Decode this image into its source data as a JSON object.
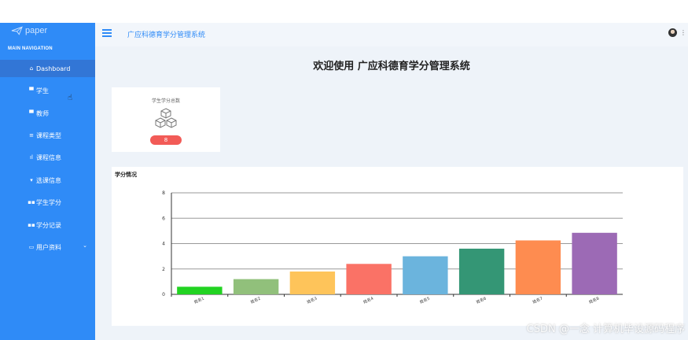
{
  "sidebar": {
    "logo_text": "paper",
    "nav_heading": "MAIN NAVIGATION",
    "items": [
      {
        "label": "Dashboard",
        "icon": "home-icon"
      },
      {
        "label": "学生",
        "icon": "chat-icon"
      },
      {
        "label": "教师",
        "icon": "card-icon"
      },
      {
        "label": "课程类型",
        "icon": "list-icon"
      },
      {
        "label": "课程信息",
        "icon": "bar-chart-icon"
      },
      {
        "label": "选课信息",
        "icon": "pin-icon"
      },
      {
        "label": "学生学分",
        "icon": "grid-icon"
      },
      {
        "label": "学分记录",
        "icon": "grid-icon"
      },
      {
        "label": "用户资料",
        "icon": "id-card-icon"
      }
    ]
  },
  "header": {
    "title": "广应科德育学分管理系统"
  },
  "main": {
    "welcome": "欢迎使用 广应科德育学分管理系统",
    "stat": {
      "title": "学生学分总数",
      "value": "8",
      "icon": "cubes-icon"
    },
    "chart_title": "学分情况"
  },
  "watermark": "CSDN @一念 计算机毕设源码程序",
  "colors": {
    "sidebar": "#2f8bf7",
    "active": "#3276d6",
    "badge": "#f25b57"
  },
  "chart_data": {
    "type": "bar",
    "title": "学分情况",
    "categories": [
      "姓名1",
      "姓名2",
      "姓名3",
      "姓名4",
      "姓名5",
      "姓名6",
      "姓名7",
      "姓名8"
    ],
    "values": [
      0.6,
      1.2,
      1.8,
      2.4,
      3.0,
      3.6,
      4.25,
      4.85
    ],
    "colors": [
      "#22d322",
      "#91c07b",
      "#fec45a",
      "#fa7266",
      "#6bb4dd",
      "#349675",
      "#fe8c50",
      "#9c6ab5"
    ],
    "yticks": [
      0,
      2,
      4,
      6,
      8
    ],
    "ylim": [
      0,
      8
    ],
    "grid": true
  }
}
